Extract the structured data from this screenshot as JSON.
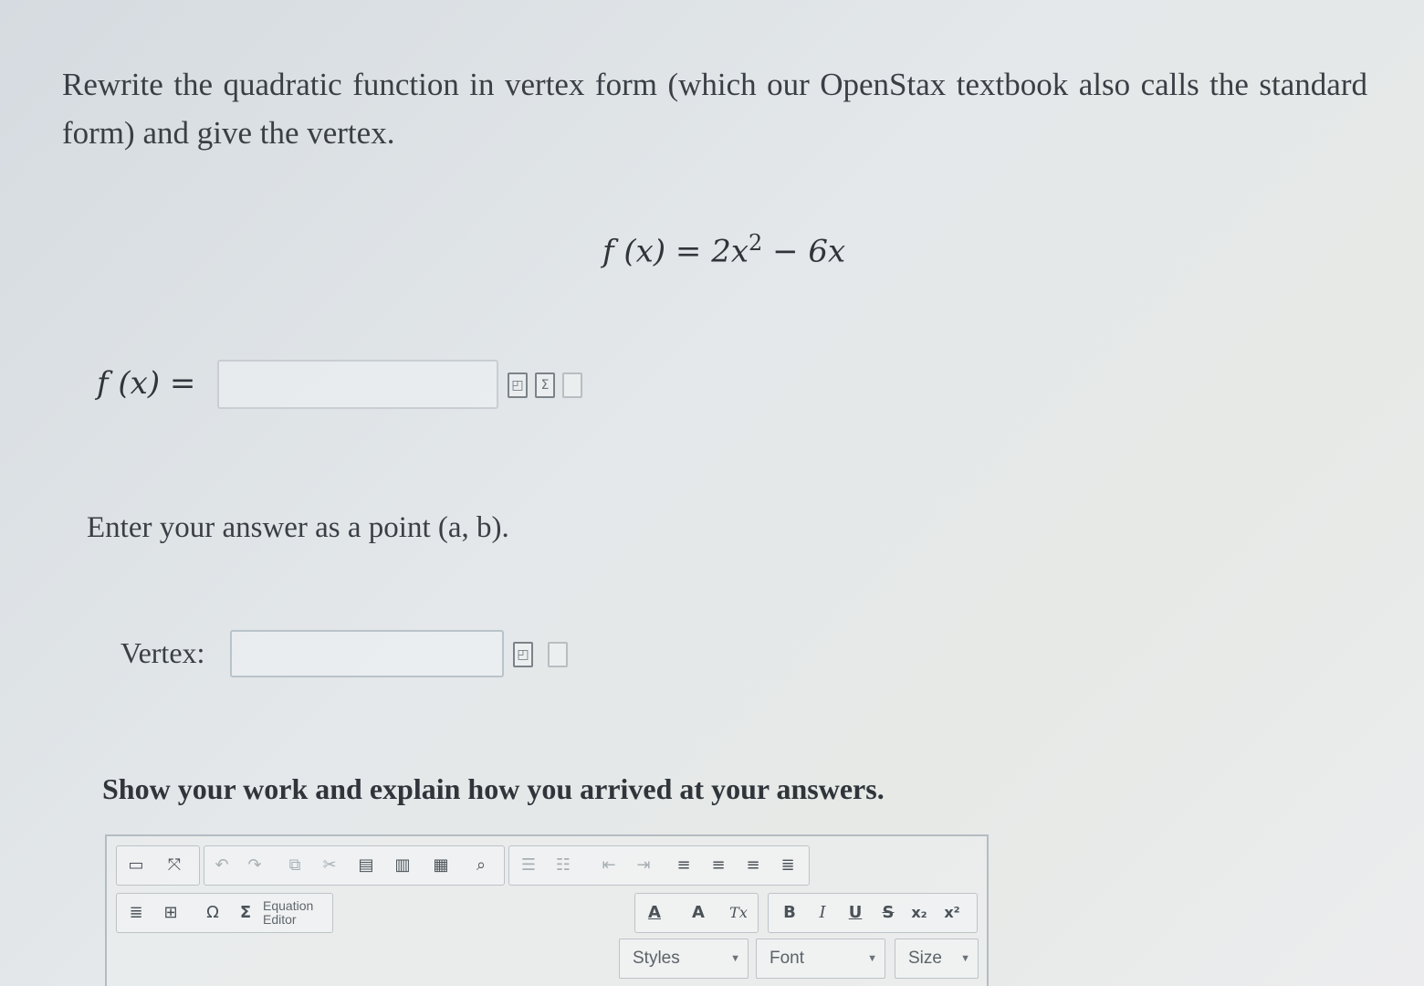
{
  "question": {
    "prompt": "Rewrite the quadratic function in vertex form (which our OpenStax textbook also calls the standard form) and give the vertex.",
    "equation_lhs": "f (x) = 2x",
    "equation_exp": "2",
    "equation_rhs": " − 6x"
  },
  "fx_answer": {
    "label": "f (x) =",
    "value": "",
    "icons": [
      "preview-icon",
      "sigma-icon",
      "document-icon"
    ]
  },
  "instruction": "Enter your answer as a point (a, b).",
  "vertex_answer": {
    "label": "Vertex:",
    "value": "",
    "icons": [
      "preview-icon",
      "document-icon"
    ]
  },
  "work_prompt": "Show your work and explain how you arrived at your answers.",
  "editor": {
    "row1_icons": [
      "source-icon",
      "maximize-icon",
      "undo-icon",
      "redo-icon",
      "copy-icon",
      "cut-icon",
      "paste-icon",
      "paste-text-icon",
      "paste-word-icon",
      "find-icon",
      "numbered-list-icon",
      "bullet-list-icon",
      "outdent-icon",
      "indent-icon",
      "align-left-icon",
      "align-center-icon",
      "align-right-icon",
      "justify-icon"
    ],
    "row2_icons": [
      "blockquote-icon",
      "table-icon",
      "omega-icon",
      "sigma-icon"
    ],
    "equation_editor_line1": "Equation",
    "equation_editor_line2": "Editor",
    "format_buttons": {
      "text_color": "A",
      "bg_color": "A",
      "remove_format": "Tx",
      "bold": "B",
      "italic": "I",
      "underline": "U",
      "strike": "S",
      "subscript": "x₂",
      "superscript": "x²"
    },
    "styles_label": "Styles",
    "font_label": "Font",
    "size_label": "Size"
  }
}
